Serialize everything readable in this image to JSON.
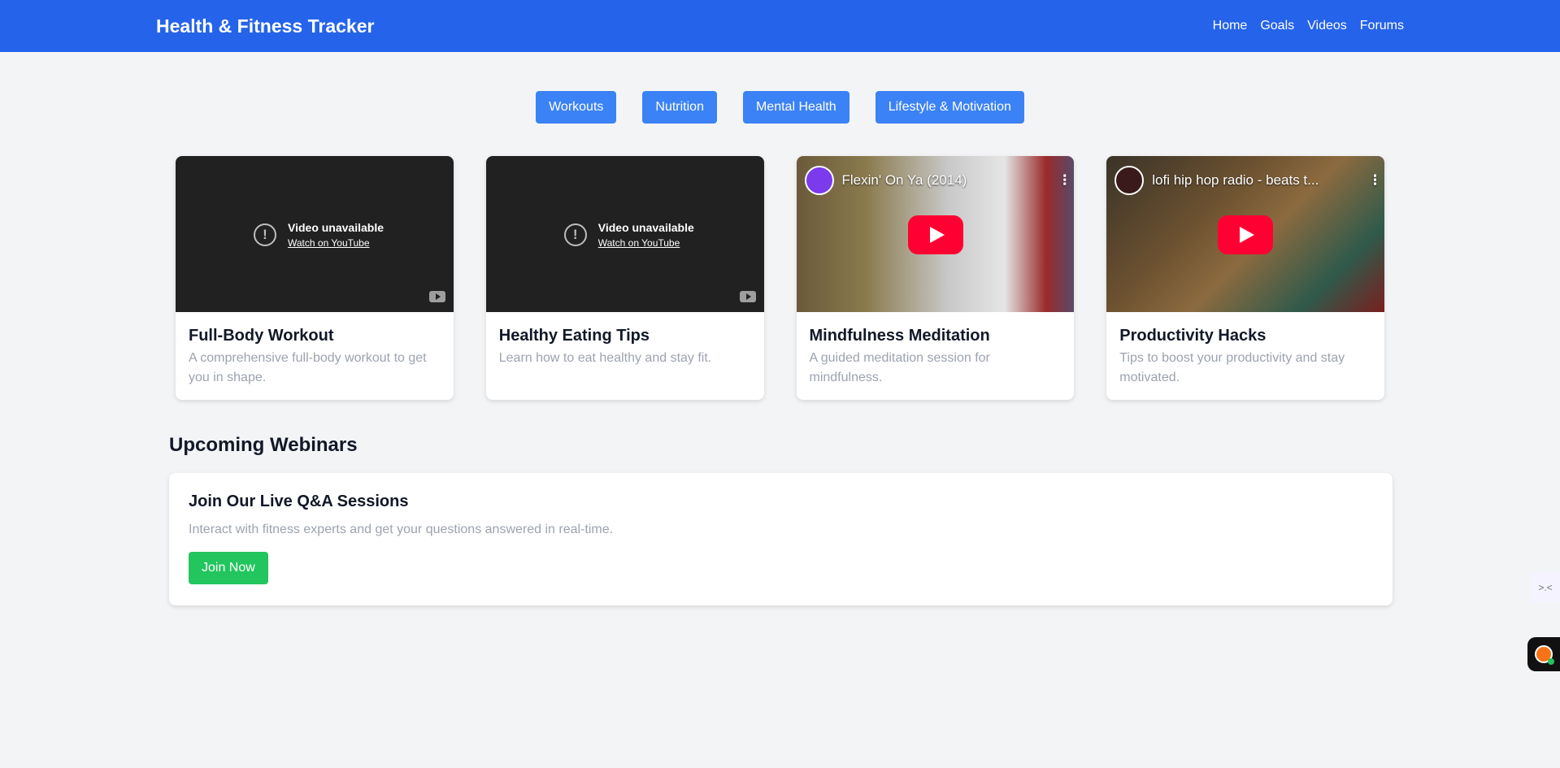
{
  "header": {
    "title": "Health & Fitness Tracker",
    "nav": [
      "Home",
      "Goals",
      "Videos",
      "Forums"
    ]
  },
  "categories": [
    "Workouts",
    "Nutrition",
    "Mental Health",
    "Lifestyle & Motivation"
  ],
  "videos": [
    {
      "player": {
        "status": "Video unavailable",
        "link": "Watch on YouTube"
      },
      "title": "Full-Body Workout",
      "description": "A comprehensive full-body workout to get you in shape."
    },
    {
      "player": {
        "status": "Video unavailable",
        "link": "Watch on YouTube"
      },
      "title": "Healthy Eating Tips",
      "description": "Learn how to eat healthy and stay fit."
    },
    {
      "player": {
        "video_title": "Flexin' On Ya (2014)"
      },
      "title": "Mindfulness Meditation",
      "description": "A guided meditation session for mindfulness."
    },
    {
      "player": {
        "video_title": "lofi hip hop radio - beats t..."
      },
      "title": "Productivity Hacks",
      "description": "Tips to boost your productivity and stay motivated."
    }
  ],
  "webinars": {
    "section_title": "Upcoming Webinars",
    "card_title": "Join Our Live Q&A Sessions",
    "description": "Interact with fitness experts and get your questions answered in real-time.",
    "button": "Join Now"
  },
  "colors": {
    "header": "#2563eb",
    "category_button": "#3b82f6",
    "join_button": "#22c55e",
    "youtube_play": "#ff0033"
  },
  "icons": [
    "alert-circle-icon",
    "youtube-logo-icon",
    "play-icon",
    "more-vert-icon",
    "extension-icon",
    "chat-bubble-icon"
  ]
}
